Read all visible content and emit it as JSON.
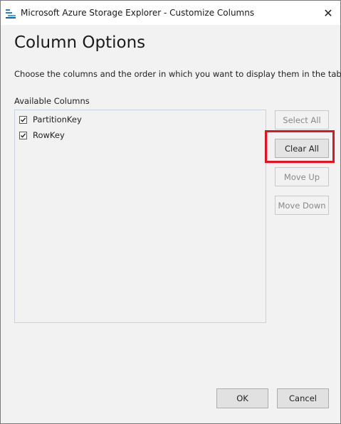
{
  "window": {
    "title": "Microsoft Azure Storage Explorer - Customize Columns",
    "app_icon": "storage-explorer-icon",
    "close_icon": "close-icon",
    "close_glyph": "✕"
  },
  "dialog": {
    "heading": "Column Options",
    "description": "Choose the columns and the order in which you want to display them in the table.",
    "list_label": "Available Columns",
    "columns": [
      {
        "label": "PartitionKey",
        "checked": true
      },
      {
        "label": "RowKey",
        "checked": true
      }
    ]
  },
  "side_buttons": {
    "select_all": "Select All",
    "clear_all": "Clear All",
    "move_up": "Move Up",
    "move_down": "Move Down"
  },
  "footer": {
    "ok": "OK",
    "cancel": "Cancel"
  },
  "colors": {
    "highlight_border": "#e8101f",
    "dialog_background": "#f2f2f2"
  }
}
